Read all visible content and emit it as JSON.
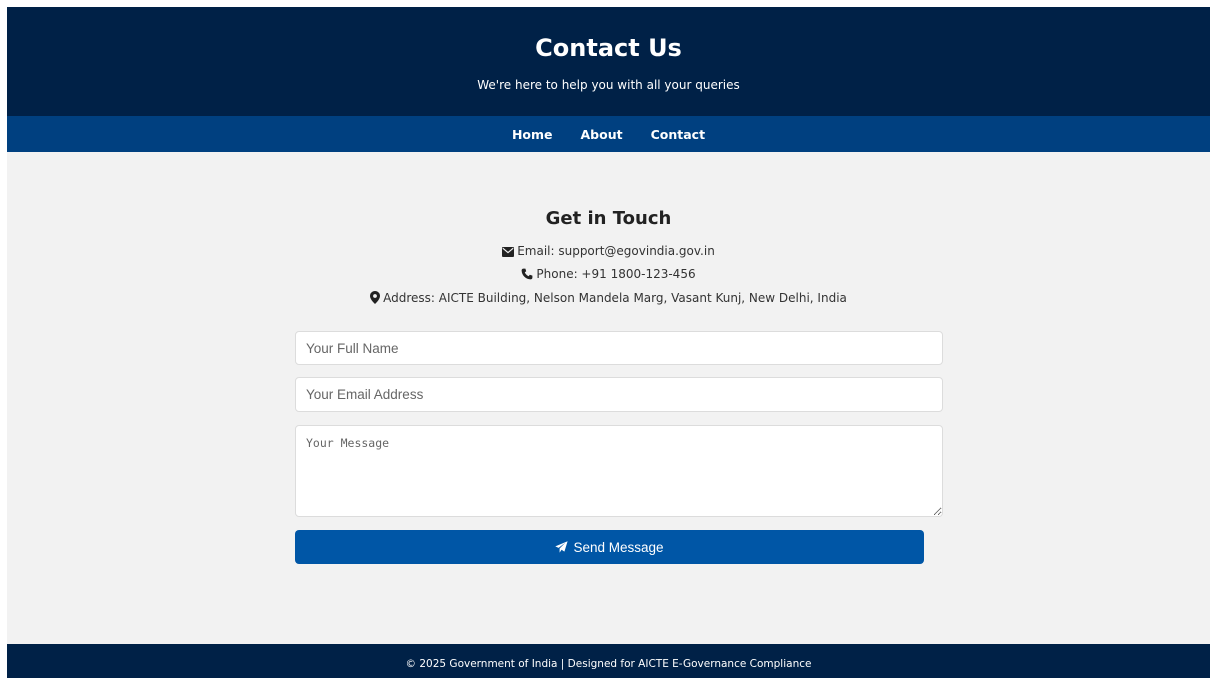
{
  "header": {
    "title": "Contact Us",
    "subtitle": "We're here to help you with all your queries"
  },
  "nav": {
    "items": [
      {
        "label": "Home"
      },
      {
        "label": "About"
      },
      {
        "label": "Contact"
      }
    ]
  },
  "contact": {
    "heading": "Get in Touch",
    "email": {
      "icon": "envelope-icon",
      "text": "Email: support@egovindia.gov.in"
    },
    "phone": {
      "icon": "phone-icon",
      "text": "Phone: +91 1800-123-456"
    },
    "address": {
      "icon": "map-marker-icon",
      "text": "Address: AICTE Building, Nelson Mandela Marg, Vasant Kunj, New Delhi, India"
    }
  },
  "form": {
    "name_placeholder": "Your Full Name",
    "email_placeholder": "Your Email Address",
    "message_placeholder": "Your Message",
    "submit_label": "Send Message",
    "submit_icon": "paper-plane-icon"
  },
  "footer": {
    "text": "© 2025 Government of India | Designed for AICTE E-Governance Compliance"
  },
  "colors": {
    "header_bg": "#002147",
    "nav_bg": "#004080",
    "button_bg": "#0056a6",
    "page_bg": "#f2f2f2"
  }
}
